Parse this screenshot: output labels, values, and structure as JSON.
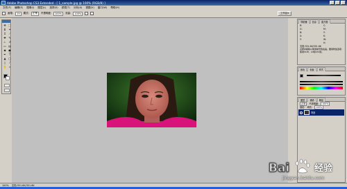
{
  "window": {
    "title": "Adobe Photoshop CS3 Extended - [ 1_sample.jpg @ 100% (RGB/8) ]"
  },
  "menu": {
    "items": [
      "文件(F)",
      "编辑(E)",
      "图像(I)",
      "图层(L)",
      "选择(S)",
      "滤镜(T)",
      "分析(A)",
      "视图(V)",
      "窗口(W)",
      "帮助(H)"
    ]
  },
  "options": {
    "size_value": "19",
    "mode_label": "模式:",
    "mode_value": "正常",
    "opacity_label": "不透明度:",
    "opacity_value": "100%",
    "flow_label": "流量:",
    "flow_value": "100%",
    "workspace_label": "工作区▾"
  },
  "panels": {
    "navigator_tabs": [
      "导航器",
      "信息",
      "直方图"
    ],
    "info_rows": [
      "R:",
      "G:",
      "B:",
      "C:",
      "M:",
      "Y:",
      "K:",
      "X:",
      "Y:",
      "W:",
      "H:"
    ],
    "doc_size": "文档:351.6K/351.6K",
    "hint_text": "点按并拖移以使用前景色绘画。要用附加选项,使用Shift、Alt和Ctrl键。",
    "color_tabs": [
      "颜色",
      "色板",
      "样式"
    ],
    "layers_tabs": [
      "图层",
      "通道",
      "路径"
    ],
    "layer_mode": "正常",
    "layer_opacity_label": "不透明度:",
    "layer_opacity": "100%",
    "layer_fill_label": "填充:",
    "layer_fill": "100%",
    "layer_name": "背景"
  },
  "status": {
    "zoom": "100%",
    "doc": "文档:351.6K/351.6K"
  },
  "watermark": {
    "brand": "Bai",
    "brand2": "经验",
    "url": "jingyan.baidu.com"
  },
  "colors": {
    "title_bar": "#0a246a",
    "chrome": "#d4d0c8",
    "canvas_bg": "#c0c0c0",
    "background_green": "#1b4a18",
    "skin": "#c9776a",
    "shirt": "#d8147a"
  }
}
